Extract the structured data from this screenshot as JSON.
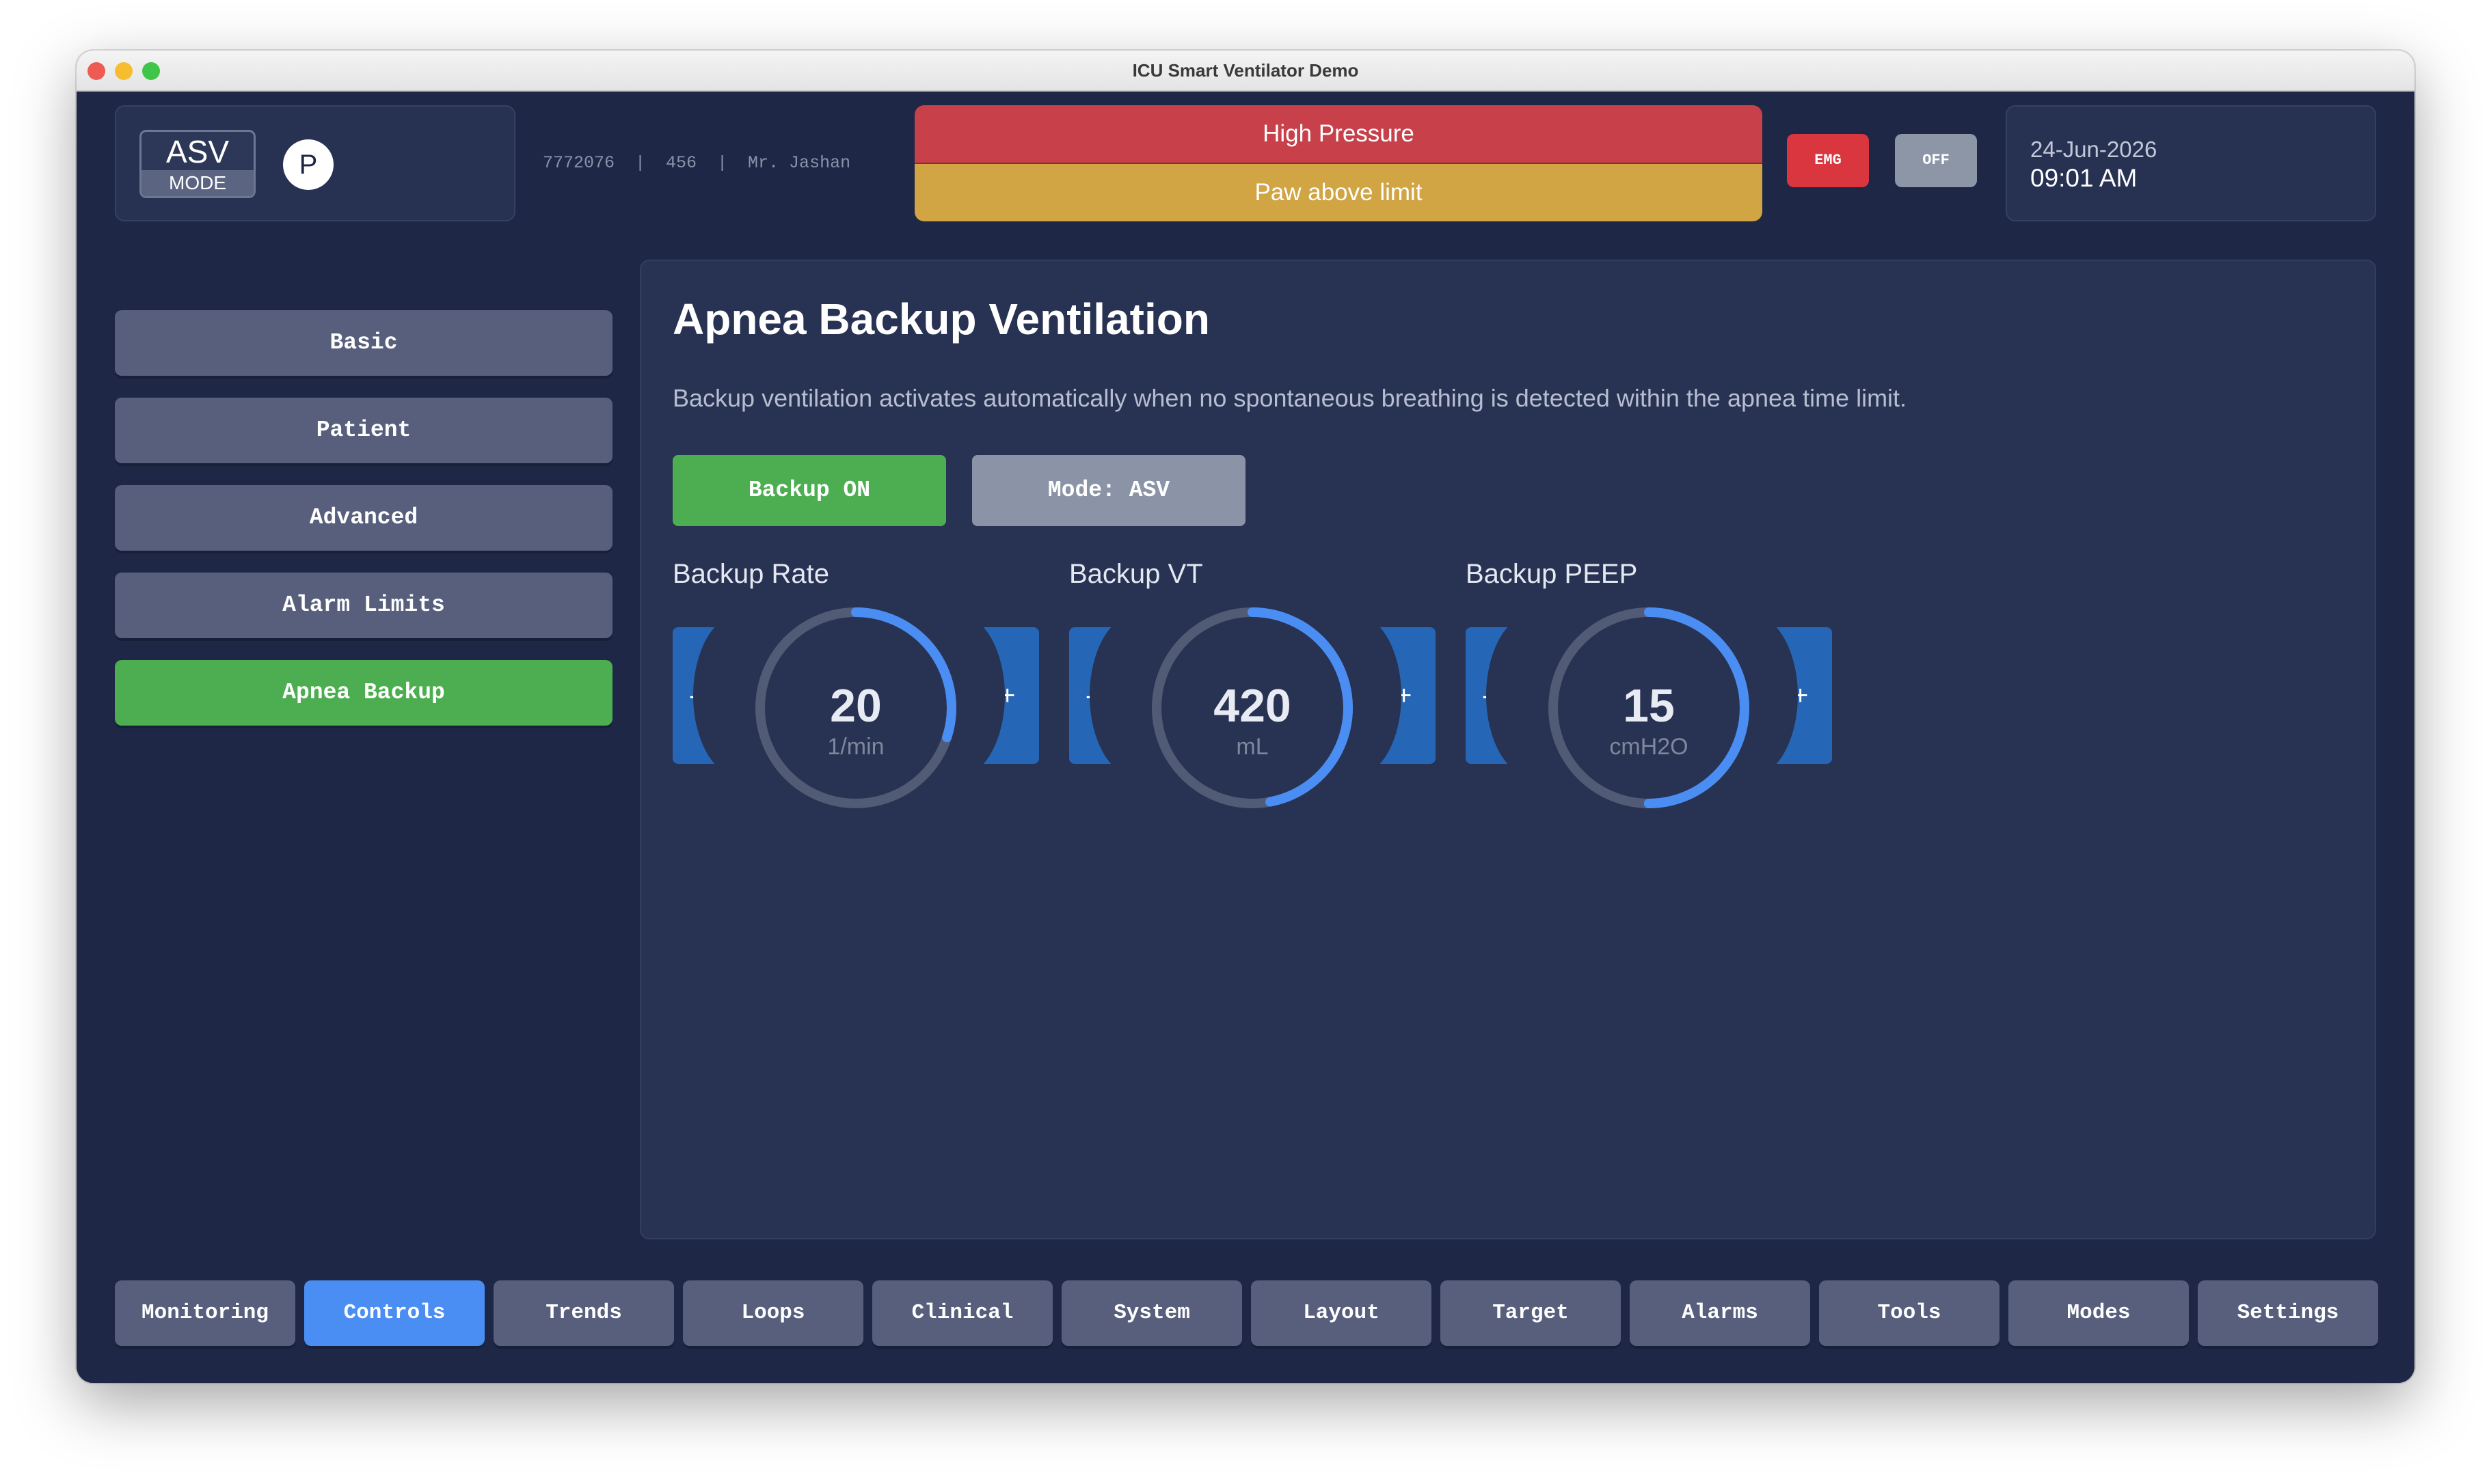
{
  "window": {
    "title": "ICU Smart Ventilator Demo"
  },
  "header": {
    "mode": {
      "name": "ASV",
      "label": "MODE"
    },
    "profile_badge": "P",
    "patient_info": "7772076  |  456  |  Mr. Jashan",
    "alarms": [
      {
        "text": "High Pressure",
        "color": "#c7404a"
      },
      {
        "text": "Paw above limit",
        "color": "#d1a444"
      }
    ],
    "emg_label": "EMG",
    "off_label": "OFF",
    "date": "24-Jun-2026",
    "time": "09:01 AM"
  },
  "sidebar": {
    "items": [
      {
        "label": "Basic",
        "active": false
      },
      {
        "label": "Patient",
        "active": false
      },
      {
        "label": "Advanced",
        "active": false
      },
      {
        "label": "Alarm Limits",
        "active": false
      },
      {
        "label": "Apnea Backup",
        "active": true
      }
    ]
  },
  "panel": {
    "title": "Apnea Backup Ventilation",
    "description": "Backup ventilation activates automatically when no spontaneous breathing is detected within the apnea time limit.",
    "backup_toggle": "Backup ON",
    "mode_button": "Mode: ASV",
    "controls": [
      {
        "label": "Backup Rate",
        "value": "20",
        "unit": "1/min",
        "fill_fraction": 0.3,
        "minus": "-",
        "plus": "+"
      },
      {
        "label": "Backup VT",
        "value": "420",
        "unit": "mL",
        "fill_fraction": 0.47,
        "minus": "-",
        "plus": "+"
      },
      {
        "label": "Backup PEEP",
        "value": "15",
        "unit": "cmH2O",
        "fill_fraction": 0.5,
        "minus": "-",
        "plus": "+"
      }
    ]
  },
  "bottom_nav": {
    "items": [
      {
        "label": "Monitoring",
        "active": false
      },
      {
        "label": "Controls",
        "active": true
      },
      {
        "label": "Trends",
        "active": false
      },
      {
        "label": "Loops",
        "active": false
      },
      {
        "label": "Clinical",
        "active": false
      },
      {
        "label": "System",
        "active": false
      },
      {
        "label": "Layout",
        "active": false
      },
      {
        "label": "Target",
        "active": false
      },
      {
        "label": "Alarms",
        "active": false
      },
      {
        "label": "Tools",
        "active": false
      },
      {
        "label": "Modes",
        "active": false
      },
      {
        "label": "Settings",
        "active": false
      }
    ]
  },
  "colors": {
    "background": "#1e2746",
    "panel": "#283252",
    "accent_green": "#4cae50",
    "accent_blue": "#4a8ef4",
    "gauge_track": "#525b76",
    "gauge_fill": "#4a8ef4",
    "stepper": "#2567b6"
  }
}
